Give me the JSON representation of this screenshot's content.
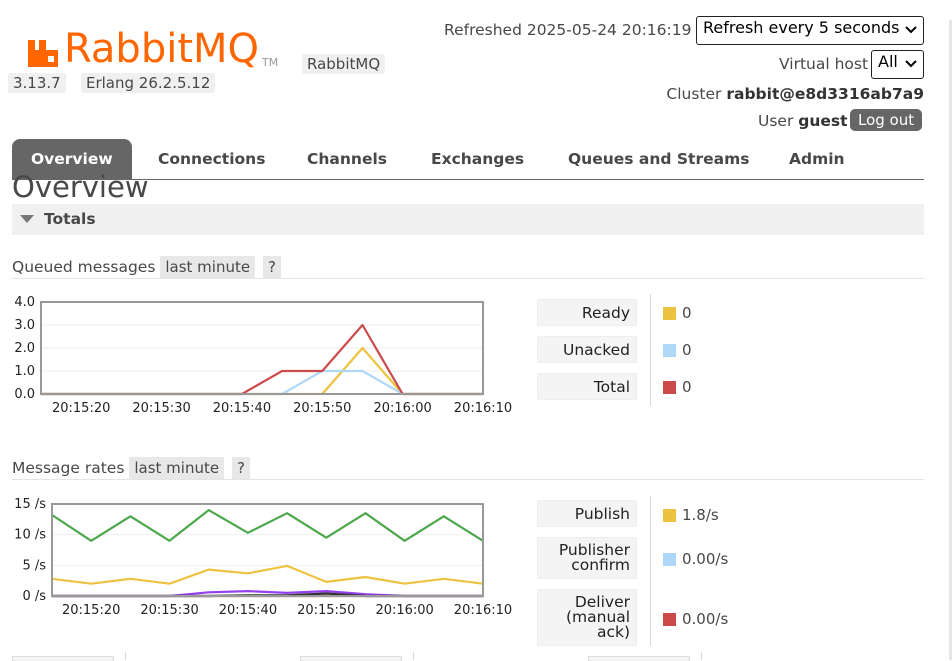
{
  "header": {
    "logo_text": "RabbitMQ",
    "logo_tm": "TM",
    "product_chip": "RabbitMQ",
    "version": "3.13.7",
    "erlang": "Erlang 26.2.5.12",
    "refreshed_label": "Refreshed 2025-05-24 20:16:19",
    "refresh_select": "Refresh every 5 seconds",
    "vhost_label": "Virtual host",
    "vhost_select": "All",
    "cluster_label": "Cluster",
    "cluster_name": "rabbit@e8d3316ab7a9",
    "user_label": "User",
    "user_name": "guest",
    "logout": "Log out",
    "logo_color": "#ff6600"
  },
  "tabs": [
    "Overview",
    "Connections",
    "Channels",
    "Exchanges",
    "Queues and Streams",
    "Admin"
  ],
  "page_title": "Overview",
  "totals": {
    "section_label": "Totals",
    "queued": {
      "heading": "Queued messages",
      "range": "last minute",
      "help": "?",
      "legend": [
        {
          "label": "Ready",
          "value": "0",
          "color": "#edc240"
        },
        {
          "label": "Unacked",
          "value": "0",
          "color": "#afd8f8"
        },
        {
          "label": "Total",
          "value": "0",
          "color": "#cb4b4b"
        }
      ]
    },
    "rates": {
      "heading": "Message rates",
      "range": "last minute",
      "help": "?",
      "legend": [
        {
          "label": "Publish",
          "value": "1.8/s",
          "color": "#edc240"
        },
        {
          "label": "Publisher confirm",
          "value": "0.00/s",
          "color": "#afd8f8"
        },
        {
          "label": "Deliver (manual ack)",
          "value": "0.00/s",
          "color": "#cb4b4b"
        }
      ]
    }
  },
  "chart_data": [
    {
      "type": "line",
      "x": [
        "20:15:15",
        "20:15:20",
        "20:15:25",
        "20:15:30",
        "20:15:35",
        "20:15:40",
        "20:15:45",
        "20:15:50",
        "20:15:55",
        "20:16:00",
        "20:16:05",
        "20:16:10"
      ],
      "xticks": [
        "20:15:20",
        "20:15:30",
        "20:15:40",
        "20:15:50",
        "20:16:00",
        "20:16:10"
      ],
      "yticks": [
        "4.0",
        "3.0",
        "2.0",
        "1.0",
        "0.0"
      ],
      "ylim": [
        0,
        4
      ],
      "series": [
        {
          "name": "Ready",
          "color": "#edc240",
          "values": [
            0,
            0,
            0,
            0,
            0,
            0,
            0,
            0,
            2,
            0,
            0,
            0
          ]
        },
        {
          "name": "Unacked",
          "color": "#afd8f8",
          "values": [
            0,
            0,
            0,
            0,
            0,
            0,
            0,
            1,
            1,
            0,
            0,
            0
          ]
        },
        {
          "name": "Total",
          "color": "#cb4b4b",
          "values": [
            0,
            0,
            0,
            0,
            0,
            0,
            1,
            1,
            3,
            0,
            0,
            0
          ]
        }
      ]
    },
    {
      "type": "line",
      "x": [
        "20:15:15",
        "20:15:20",
        "20:15:25",
        "20:15:30",
        "20:15:35",
        "20:15:40",
        "20:15:45",
        "20:15:50",
        "20:15:55",
        "20:16:00",
        "20:16:05",
        "20:16:10"
      ],
      "xticks": [
        "20:15:20",
        "20:15:30",
        "20:15:40",
        "20:15:50",
        "20:16:00",
        "20:16:10"
      ],
      "yticks": [
        "15 /s",
        "10 /s",
        "5 /s",
        "0 /s"
      ],
      "ylim": [
        0,
        15
      ],
      "series": [
        {
          "name": "Publish",
          "color": "#edc240",
          "values": [
            2.8,
            2.0,
            2.8,
            2.0,
            4.3,
            3.7,
            4.9,
            2.3,
            3.1,
            2.0,
            2.8,
            2.0
          ]
        },
        {
          "name": "Publisher confirm",
          "color": "#afd8f8",
          "values": [
            0,
            0,
            0,
            0,
            0,
            0,
            0,
            0,
            0,
            0,
            0,
            0
          ]
        },
        {
          "name": "Deliver (manual ack)",
          "color": "#cb4b4b",
          "values": [
            0,
            0,
            0,
            0,
            0,
            0,
            0,
            0,
            0,
            0,
            0,
            0
          ]
        },
        {
          "color": "#4da74d",
          "values": [
            13.2,
            9.0,
            13.0,
            9.0,
            14.0,
            10.3,
            13.5,
            9.5,
            13.5,
            9.0,
            13.0,
            9.0
          ]
        },
        {
          "color": "#9440ed",
          "values": [
            0,
            0,
            0,
            0,
            0.6,
            0.8,
            0.5,
            0.8,
            0.3,
            0,
            0,
            0
          ]
        },
        {
          "color": "#333333",
          "values": [
            0,
            0,
            0,
            0,
            0,
            0.1,
            0.1,
            0.4,
            0,
            0,
            0,
            0
          ]
        }
      ]
    }
  ]
}
